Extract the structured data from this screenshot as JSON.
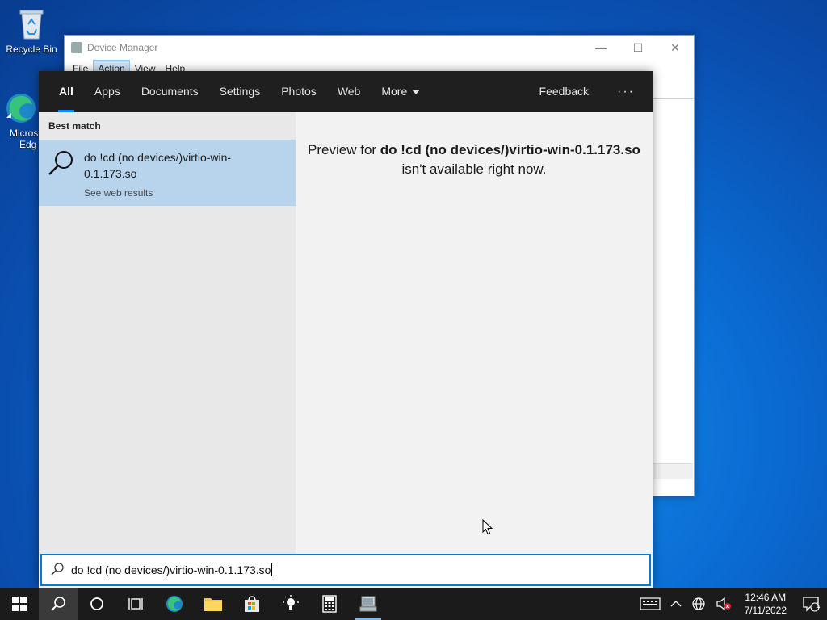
{
  "desktop": {
    "recycle_bin_label": "Recycle Bin",
    "edge_label_line1": "Micros",
    "edge_label_line2": "Edg"
  },
  "device_manager": {
    "title": "Device Manager",
    "menu": [
      "File",
      "Action",
      "View",
      "Help"
    ],
    "active_menu": "Action",
    "controls": [
      "—",
      "☐",
      "✕"
    ]
  },
  "search": {
    "tabs": [
      "All",
      "Apps",
      "Documents",
      "Settings",
      "Photos",
      "Web",
      "More"
    ],
    "active_tab": "All",
    "feedback_label": "Feedback",
    "more_options_label": "···",
    "best_match_heading": "Best match",
    "result": {
      "title_line1": "do !cd (no devices/)virtio-win-",
      "title_line2": "0.1.173.so",
      "subtitle": "See web results"
    },
    "preview": {
      "prefix": "Preview for ",
      "query": "do !cd (no devices/)virtio-win-0.1.173.so",
      "suffix": "isn't available right now."
    },
    "query_value": "do !cd (no devices/)virtio-win-0.1.173.so"
  },
  "taskbar": {
    "clock_time": "12:46 AM",
    "clock_date": "7/11/2022",
    "notification_count": "1"
  },
  "colors": {
    "accent": "#0a78d7",
    "selection": "#b7d4ec",
    "taskbar": "#1b1b1b"
  }
}
